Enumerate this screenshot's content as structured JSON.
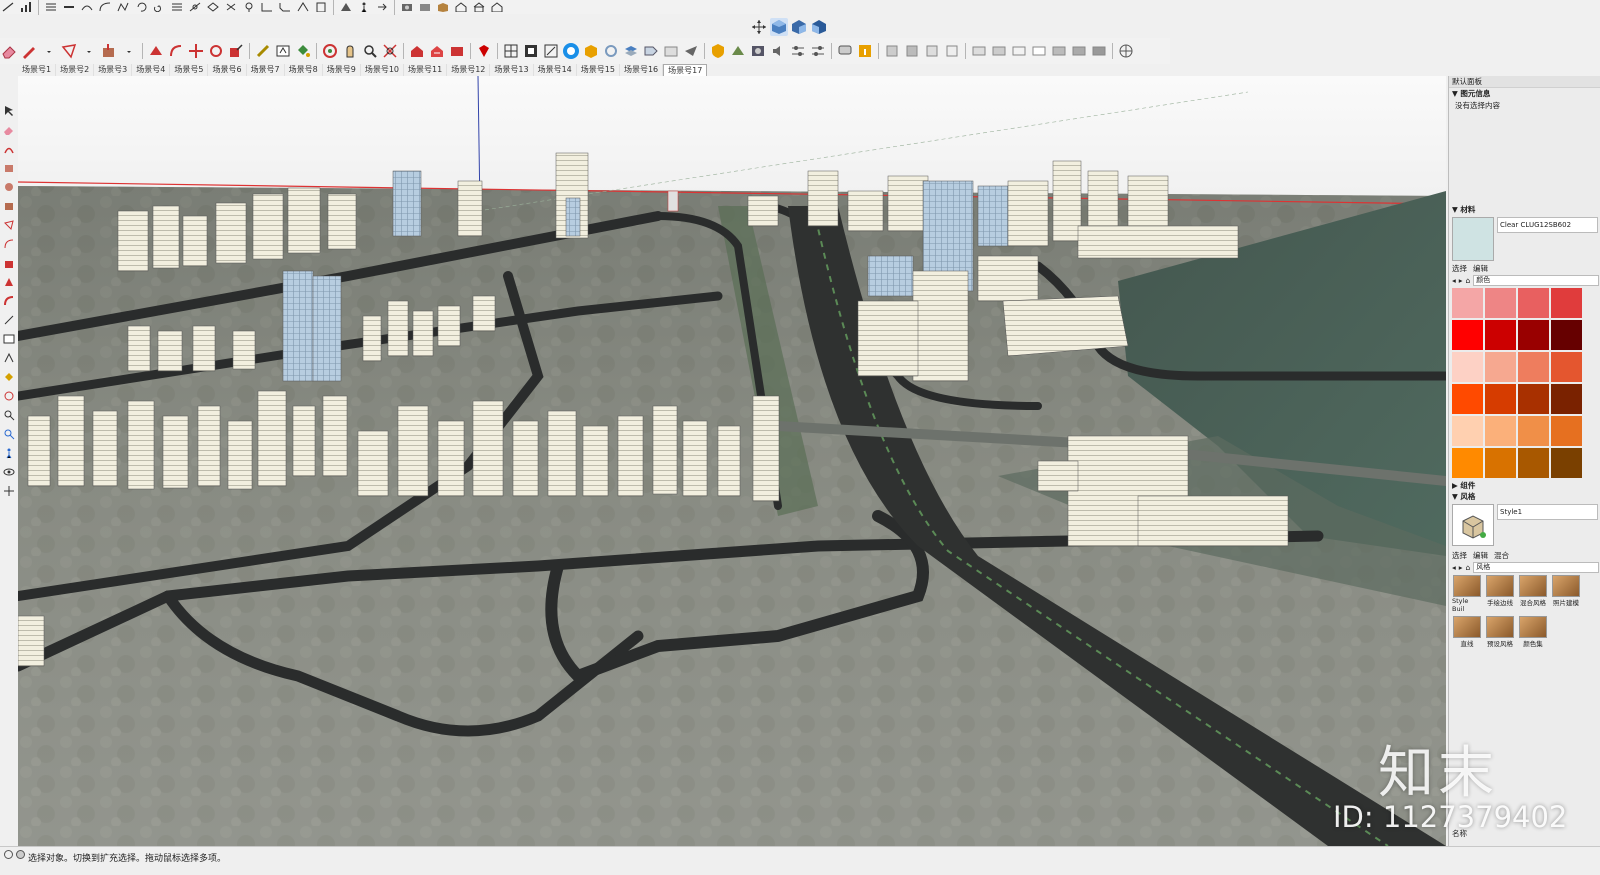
{
  "scene_tabs": [
    "场景号1",
    "场景号2",
    "场景号3",
    "场景号4",
    "场景号5",
    "场景号6",
    "场景号7",
    "场景号8",
    "场景号9",
    "场景号10",
    "场景号11",
    "场景号12",
    "场景号13",
    "场景号14",
    "场景号15",
    "场景号16",
    "场景号17"
  ],
  "active_scene_index": 16,
  "panel": {
    "tray_title": "默认面板",
    "entity_info": {
      "header": "▼ 图元信息",
      "text": "没有选择内容"
    },
    "materials": {
      "header": "▼ 材料",
      "current_name": "Clear CLUG12SB602",
      "tab_select": "选择",
      "tab_edit": "编辑",
      "library": "颜色",
      "swatch_colors": [
        "#f4a6a6",
        "#ee8585",
        "#e86060",
        "#e03c3c",
        "#ff0000",
        "#cc0000",
        "#990000",
        "#660000",
        "#fdd1c5",
        "#f6a890",
        "#ee7d5e",
        "#e4562f",
        "#ff4a00",
        "#d63c00",
        "#a83000",
        "#7a2200",
        "#ffd0b0",
        "#fbb07a",
        "#f08f48",
        "#e67020",
        "#ff8a00",
        "#d87200",
        "#a85800",
        "#7a4000"
      ]
    },
    "components": {
      "header": "▶ 组件"
    },
    "styles": {
      "header": "▼ 风格",
      "current_name": "Style1",
      "tab_select": "选择",
      "tab_edit": "编辑",
      "tab_mix": "混合",
      "library": "风格",
      "items": [
        "Style Buil",
        "手绘边线",
        "混合风格",
        "照片建模",
        "直线",
        "预设风格",
        "颜色集"
      ]
    },
    "bottom_label": "名称",
    "bottom_value": "数值"
  },
  "status": {
    "text": "选择对象。切换到扩充选择。拖动鼠标选择多项。"
  },
  "watermark": {
    "logo": "知末",
    "id": "ID: 1127379402"
  }
}
